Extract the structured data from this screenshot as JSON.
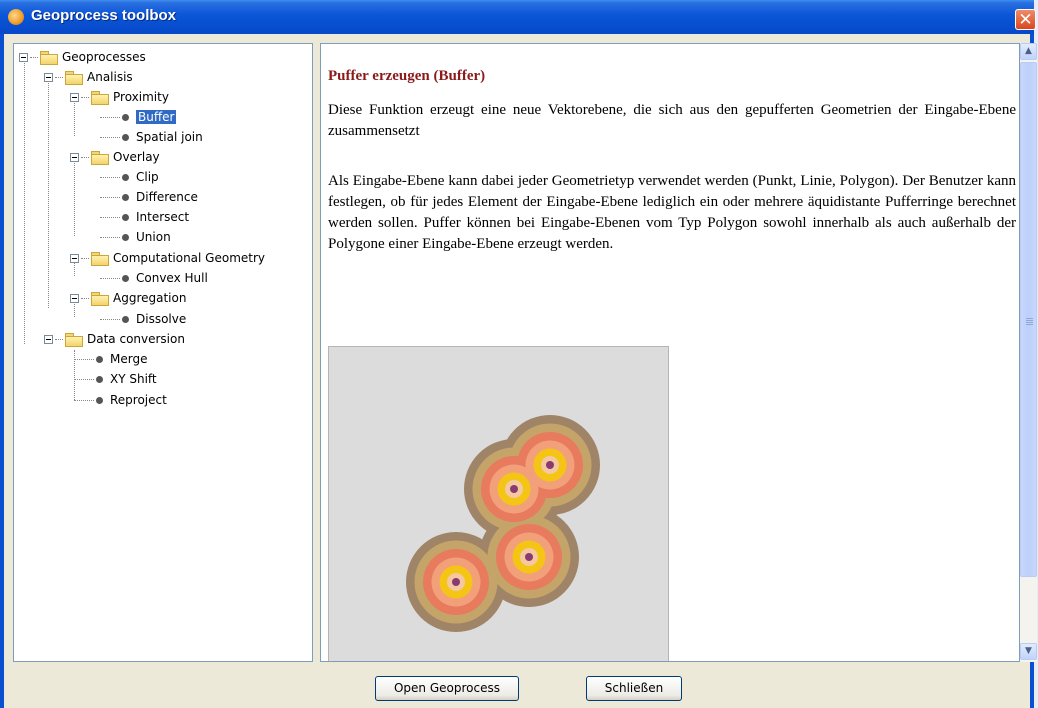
{
  "window": {
    "title": "Geoprocess toolbox",
    "close_glyph": "✕"
  },
  "tree": {
    "root": "Geoprocesses",
    "analisis": "Analisis",
    "proximity": "Proximity",
    "buffer": "Buffer",
    "spatial_join": "Spatial join",
    "overlay": "Overlay",
    "clip": "Clip",
    "difference": "Difference",
    "intersect": "Intersect",
    "union": "Union",
    "computational_geometry": "Computational Geometry",
    "convex_hull": "Convex Hull",
    "aggregation": "Aggregation",
    "dissolve": "Dissolve",
    "data_conversion": "Data conversion",
    "merge": "Merge",
    "xy_shift": "XY Shift",
    "reproject": "Reproject",
    "selected": "Buffer"
  },
  "doc": {
    "heading": "Puffer erzeugen (Buffer)",
    "paragraph1": "Diese Funktion erzeugt eine neue Vektorebene, die sich aus den gepufferten Geometrien der Eingabe-Ebene zusammensetzt",
    "paragraph2": "Als Eingabe-Ebene kann dabei jeder Geometrietyp verwendet werden (Punkt, Linie, Polygon). Der Benutzer kann festlegen, ob für jedes Element der Eingabe-Ebene lediglich ein oder mehrere äquidistante Pufferringe berechnet werden sollen. Puffer können bei Eingabe-Ebenen vom Typ Polygon sowohl innerhalb als auch außerhalb der Polygone einer Eingabe-Ebene erzeugt werden."
  },
  "buttons": {
    "open": "Open Geoprocess",
    "close": "Schließen"
  },
  "colors": {
    "ring_outer": "#a08468",
    "ring_2": "#c4a468",
    "ring_3": "#e87a5e",
    "ring_4": "#f2a07a",
    "ring_5": "#f5c516",
    "core": "#f4c8a0",
    "point": "#8a3a6e"
  },
  "icons": {
    "scroll_up": "▲",
    "scroll_down": "▼"
  }
}
